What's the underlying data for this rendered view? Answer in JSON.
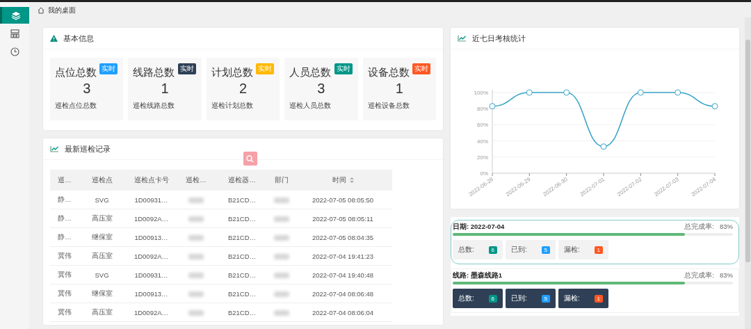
{
  "sidebar": {
    "items": [
      {
        "selected": true
      },
      {
        "selected": false
      },
      {
        "selected": false
      }
    ]
  },
  "breadcrumb": "我的桌面",
  "basic_info": {
    "title": "基本信息",
    "cards": [
      {
        "title": "点位总数",
        "badge": "实时",
        "color": "#1e9fff",
        "value": "3",
        "caption": "巡检点位总数"
      },
      {
        "title": "线路总数",
        "badge": "实时",
        "color": "#2f4056",
        "value": "1",
        "caption": "巡检线路总数"
      },
      {
        "title": "计划总数",
        "badge": "实时",
        "color": "#ffb800",
        "value": "2",
        "caption": "巡检计划总数"
      },
      {
        "title": "人员总数",
        "badge": "实时",
        "color": "#009688",
        "value": "3",
        "caption": "巡检人员总数"
      },
      {
        "title": "设备总数",
        "badge": "实时",
        "color": "#ff5722",
        "value": "1",
        "caption": "巡检设备总数"
      }
    ]
  },
  "records": {
    "title": "最新巡检记录",
    "columns": [
      "巡…",
      "巡检点",
      "巡检点卡号",
      "巡检…",
      "巡检器…",
      "部门",
      "时间"
    ],
    "rows": [
      [
        "静…",
        "SVG",
        "1D00931…",
        null,
        "B21CD…",
        null,
        "2022-07-05 08:05:50"
      ],
      [
        "静…",
        "高压室",
        "1D0092A…",
        null,
        "B21CD…",
        null,
        "2022-07-05 08:05:11"
      ],
      [
        "静…",
        "继保室",
        "1D00913…",
        null,
        "B21CD…",
        null,
        "2022-07-05 08:04:35"
      ],
      [
        "冀伟",
        "高压室",
        "1D0092A…",
        null,
        "B21CD…",
        null,
        "2022-07-04 19:41:23"
      ],
      [
        "冀伟",
        "SVG",
        "1D00931…",
        null,
        "B21CD…",
        null,
        "2022-07-04 19:40:48"
      ],
      [
        "冀伟",
        "继保室",
        "1D00913…",
        null,
        "B21CD…",
        null,
        "2022-07-04 08:06:48"
      ],
      [
        "冀伟",
        "高压室",
        "1D0092A…",
        null,
        "B21CD…",
        null,
        "2022-07-04 08:06:04"
      ]
    ]
  },
  "weekly": {
    "title": "近七日考核统计",
    "chart_data": {
      "type": "line",
      "categories": [
        "2022-06-28",
        "2022-06-29",
        "2022-06-30",
        "2022-07-01",
        "2022-07-02",
        "2022-07-03",
        "2022-07-04"
      ],
      "series": [
        {
          "color": "#3aa5c8",
          "values": [
            83,
            100,
            100,
            33,
            100,
            100,
            83
          ],
          "marker": true
        }
      ],
      "grid": true,
      "ylim": [
        0,
        100
      ],
      "yticks": [
        {
          "value": 0,
          "label": "0%"
        },
        {
          "value": 20,
          "label": "20%"
        },
        {
          "value": 40,
          "label": "40%"
        },
        {
          "value": 60,
          "label": "60%"
        },
        {
          "value": 80,
          "label": "80%"
        },
        {
          "value": 100,
          "label": "100%"
        }
      ]
    }
  },
  "summaries": [
    {
      "kind": "light",
      "title": "日期: 2022-07-04",
      "rate_label": "总完成率:",
      "rate": "83%",
      "level": 0.83,
      "stats": [
        {
          "label": "总数:",
          "value": "6",
          "color": "#009688"
        },
        {
          "label": "已到:",
          "value": "5",
          "color": "#1e9fff"
        },
        {
          "label": "漏检:",
          "value": "1",
          "color": "#ff5722"
        }
      ]
    },
    {
      "kind": "dark",
      "title": "线路: 墨森线路1",
      "rate_label": "总完成率:",
      "rate": "83%",
      "level": 0.83,
      "stats": [
        {
          "label": "总数:",
          "value": "6",
          "color": "#009688"
        },
        {
          "label": "已到:",
          "value": "5",
          "color": "#1e9fff"
        },
        {
          "label": "漏检:",
          "value": "1",
          "color": "#ff5722"
        }
      ]
    }
  ]
}
